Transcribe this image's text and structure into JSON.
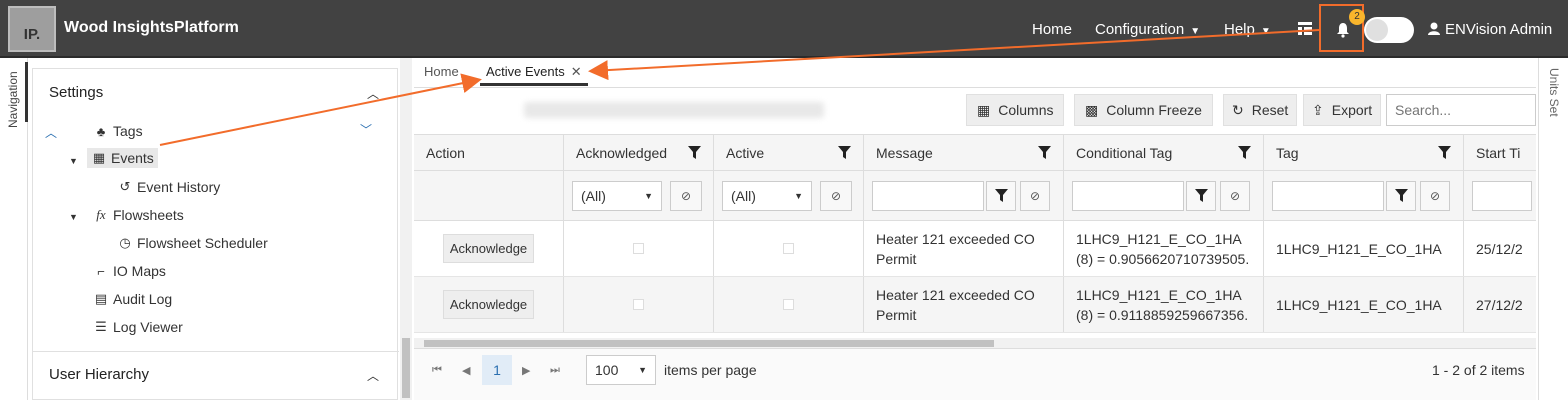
{
  "app": {
    "logo_text": "IP.",
    "title": "Wood InsightsPlatform"
  },
  "topnav": {
    "home": "Home",
    "configuration": "Configuration",
    "help": "Help",
    "notification_count": "2",
    "user_name": "ENVision Admin"
  },
  "left_rail": {
    "label": "Navigation"
  },
  "right_rail": {
    "label": "Units Set"
  },
  "sidebar": {
    "settings_header": "Settings",
    "items": [
      {
        "label": "Tags",
        "icon": "tags-icon"
      },
      {
        "label": "Events",
        "icon": "calendar-icon",
        "selected": true
      },
      {
        "label": "Event History",
        "icon": "history-icon"
      },
      {
        "label": "Flowsheets",
        "icon": "fx-icon"
      },
      {
        "label": "Flowsheet Scheduler",
        "icon": "clock-icon"
      },
      {
        "label": "IO Maps",
        "icon": "io-icon"
      },
      {
        "label": "Audit Log",
        "icon": "clipboard-icon"
      },
      {
        "label": "Log Viewer",
        "icon": "list-icon"
      }
    ],
    "user_hierarchy_header": "User Hierarchy"
  },
  "tabs": [
    {
      "label": "Home"
    },
    {
      "label": "Active Events",
      "closable": true
    }
  ],
  "toolbar": {
    "columns": "Columns",
    "column_freeze": "Column Freeze",
    "reset": "Reset",
    "export": "Export",
    "search_placeholder": "Search..."
  },
  "grid": {
    "headers": [
      "Action",
      "Acknowledged",
      "Active",
      "Message",
      "Conditional Tag",
      "Tag",
      "Start Ti"
    ],
    "filter_all": "(All)",
    "rows": [
      {
        "action": "Acknowledge",
        "message": "Heater 121 exceeded CO Permit",
        "conditional_tag": "1LHC9_H121_E_CO_1HA (8) = 0.9056620710739505.",
        "tag": "1LHC9_H121_E_CO_1HA",
        "start_time": "25/12/2"
      },
      {
        "action": "Acknowledge",
        "message": "Heater 121 exceeded CO Permit",
        "conditional_tag": "1LHC9_H121_E_CO_1HA (8) = 0.9118859259667356.",
        "tag": "1LHC9_H121_E_CO_1HA",
        "start_time": "27/12/2"
      }
    ]
  },
  "pager": {
    "current_page": "1",
    "page_size": "100",
    "items_per_page": "items per page",
    "summary": "1 - 2 of 2 items"
  },
  "colors": {
    "topbar": "#424242",
    "accent_orange": "#f26c2b",
    "badge": "#f9b52c",
    "active_page": "#e1ecf7"
  }
}
